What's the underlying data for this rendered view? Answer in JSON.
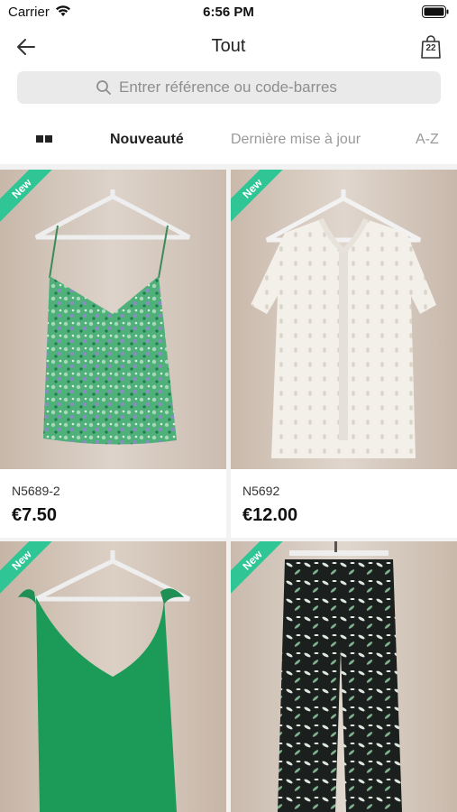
{
  "status_bar": {
    "carrier": "Carrier",
    "time": "6:56 PM"
  },
  "nav": {
    "title": "Tout",
    "cart_count": "22"
  },
  "search": {
    "placeholder": "Entrer référence ou code-barres"
  },
  "sort": {
    "tabs": [
      {
        "label": "Nouveauté",
        "active": true
      },
      {
        "label": "Dernière mise à jour",
        "active": false
      },
      {
        "label": "A-Z",
        "active": false
      }
    ]
  },
  "products": [
    {
      "badge": "New",
      "ref": "N5689-2",
      "price": "€7.50"
    },
    {
      "badge": "New",
      "ref": "N5692",
      "price": "€12.00"
    },
    {
      "badge": "New"
    },
    {
      "badge": "New"
    }
  ],
  "colors": {
    "badge": "#2fc595",
    "search_bg": "#eaeaea"
  }
}
